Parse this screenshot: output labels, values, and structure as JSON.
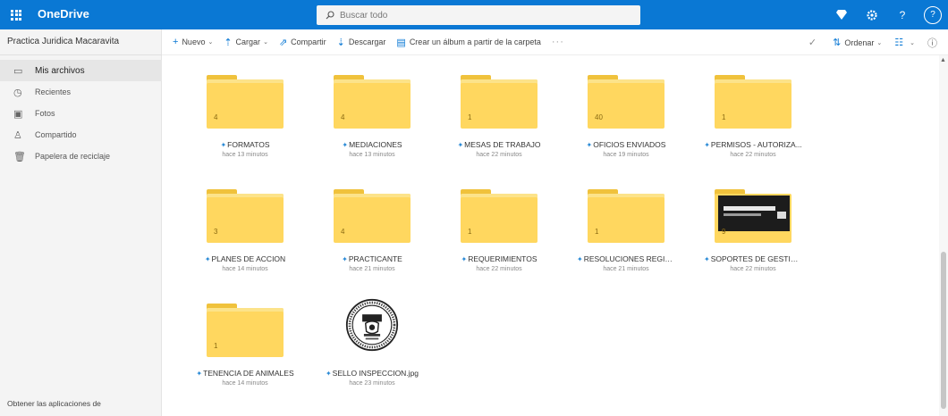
{
  "header": {
    "app_title": "OneDrive",
    "search_placeholder": "Buscar todo",
    "avatar_initial": "?"
  },
  "sidebar": {
    "account_name": "Practica Juridica Macaravita",
    "items": [
      {
        "label": "Mis archivos",
        "icon": "folder-icon",
        "active": true
      },
      {
        "label": "Recientes",
        "icon": "clock-icon",
        "active": false
      },
      {
        "label": "Fotos",
        "icon": "photo-icon",
        "active": false
      },
      {
        "label": "Compartido",
        "icon": "people-icon",
        "active": false
      },
      {
        "label": "Papelera de reciclaje",
        "icon": "trash-icon",
        "active": false
      }
    ],
    "get_apps": "Obtener las aplicaciones de"
  },
  "commandbar": {
    "new": "Nuevo",
    "upload": "Cargar",
    "share": "Compartir",
    "download": "Descargar",
    "create_album": "Crear un álbum a partir de la carpeta",
    "more": "···",
    "sort": "Ordenar",
    "view": "☷"
  },
  "items": [
    {
      "type": "folder",
      "name": "FORMATOS",
      "time": "hace 13 minutos",
      "count": "4"
    },
    {
      "type": "folder",
      "name": "MEDIACIONES",
      "time": "hace 13 minutos",
      "count": "4"
    },
    {
      "type": "folder",
      "name": "MESAS DE TRABAJO",
      "time": "hace 22 minutos",
      "count": "1"
    },
    {
      "type": "folder",
      "name": "OFICIOS ENVIADOS",
      "time": "hace 19 minutos",
      "count": "40"
    },
    {
      "type": "folder",
      "name": "PERMISOS - AUTORIZA...",
      "time": "hace 22 minutos",
      "count": "1"
    },
    {
      "type": "folder",
      "name": "PLANES DE ACCION",
      "time": "hace 14 minutos",
      "count": "3"
    },
    {
      "type": "folder",
      "name": "PRACTICANTE",
      "time": "hace 21 minutos",
      "count": "4"
    },
    {
      "type": "folder",
      "name": "REQUERIMIENTOS",
      "time": "hace 22 minutos",
      "count": "1"
    },
    {
      "type": "folder",
      "name": "RESOLUCIONES REGIST...",
      "time": "hace 21 minutos",
      "count": "1"
    },
    {
      "type": "folder-preview",
      "name": "SOPORTES DE GESTION...",
      "time": "hace 22 minutos",
      "count": "9"
    },
    {
      "type": "folder",
      "name": "TENENCIA DE ANIMALES",
      "time": "hace 14 minutos",
      "count": "1"
    },
    {
      "type": "image",
      "name": "SELLO INSPECCION.jpg",
      "time": "hace 23 minutos"
    }
  ],
  "colors": {
    "brand": "#0a78d4",
    "folder": "#ffd75f",
    "folder_tab": "#f0c23c"
  }
}
